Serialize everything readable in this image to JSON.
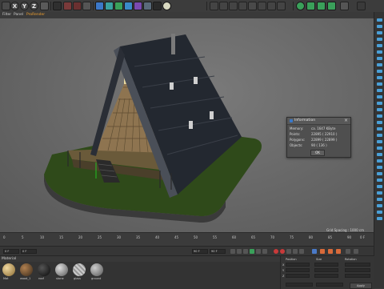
{
  "toolbar": {
    "axis_x": "X",
    "axis_y": "Y",
    "axis_z": "Z"
  },
  "viewport_menu": {
    "items": [
      "Filter",
      "Panel",
      "ProRender"
    ]
  },
  "viewport": {
    "grid_spacing": "Grid Spacing : 1000 cm"
  },
  "info_dialog": {
    "title": "Information",
    "rows": [
      {
        "label": "Memory:",
        "value": "ca. 1647 KByte"
      },
      {
        "label": "Points:",
        "value": "22895 ( 22910 )"
      },
      {
        "label": "Polygons:",
        "value": "22899 ( 22899 )"
      },
      {
        "label": "Objects:",
        "value": "90 ( 136 )"
      }
    ],
    "ok_label": "OK"
  },
  "timeline": {
    "ticks": [
      "0",
      "5",
      "10",
      "15",
      "20",
      "25",
      "30",
      "35",
      "40",
      "45",
      "50",
      "55",
      "60",
      "65",
      "70",
      "75",
      "80",
      "85",
      "90"
    ],
    "current_frame": "0 F"
  },
  "transport": {
    "start_field": "0 F",
    "end_field": "90 F",
    "min_field": "0 F",
    "max_field": "90 F"
  },
  "materials": {
    "menu": [
      "Create",
      "Edit",
      "Function",
      "Texture"
    ],
    "label": "Material",
    "items": [
      {
        "name": "Mat",
        "color": "#c8a56a"
      },
      {
        "name": "wood_1",
        "color": "#7a5a3a"
      },
      {
        "name": "roof",
        "color": "#1e1e1e"
      },
      {
        "name": "stone",
        "color": "#9a9a9a"
      },
      {
        "name": "glass",
        "color": "#b8b8b8"
      },
      {
        "name": "ground",
        "color": "#8c8c8c"
      }
    ]
  },
  "coords": {
    "header": [
      "Position",
      "Size",
      "Rotation"
    ],
    "rows": [
      {
        "axis": "X",
        "pos": "0 cm",
        "size": "0 cm",
        "rot": "H 0°"
      },
      {
        "axis": "Y",
        "pos": "0 cm",
        "size": "0 cm",
        "rot": "P 0°"
      },
      {
        "axis": "Z",
        "pos": "0 cm",
        "size": "0 cm",
        "rot": "B 0°"
      }
    ],
    "mode1": "Object (Rel)",
    "mode2": "Size",
    "apply": "Apply"
  }
}
